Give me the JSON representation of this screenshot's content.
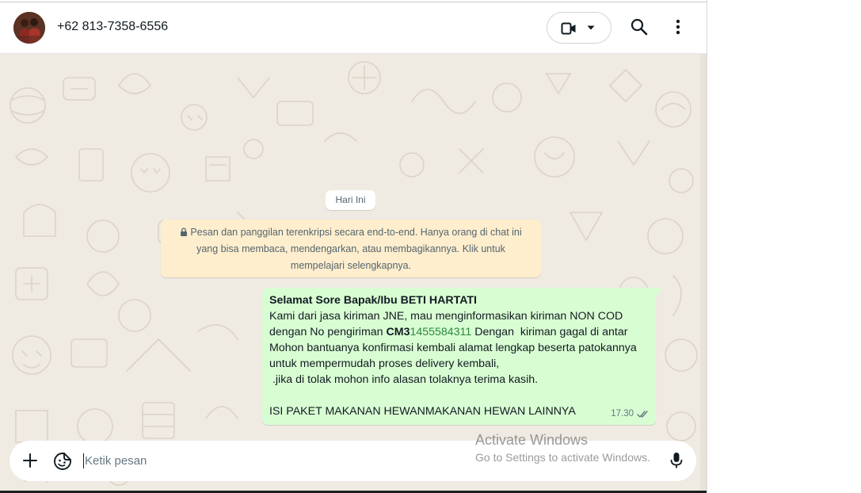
{
  "header": {
    "contact_name": "+62 813-7358-6556"
  },
  "chat": {
    "date_chip": "Hari Ini",
    "encryption_notice": "Pesan dan panggilan terenkripsi secara end-to-end. Hanya orang di chat ini yang bisa membaca, mendengarkan, atau membagikannya. Klik untuk mempelajari selengkapnya.",
    "message": {
      "line1": "Selamat Sore Bapak/Ibu BETI HARTATI",
      "line2": "Kami dari jasa kiriman JNE, mau menginformasikan kiriman NON COD",
      "line3_prefix": "dengan No pengiriman ",
      "line3_code": "CM3",
      "line3_number": "1455584311",
      "line3_suffix": " Dengan  kiriman gagal di antar",
      "line4": "Mohon bantuanya konfirmasi kembali alamat lengkap beserta patokannya",
      "line5": "untuk mempermudah proses delivery kembali,",
      "line6": " .jika di tolak mohon info alasan tolaknya terima kasih.",
      "line7": "ISI PAKET MAKANAN HEWANMAKANAN HEWAN LAINNYA",
      "time": "17.30",
      "status": "read"
    }
  },
  "composer": {
    "placeholder": "Ketik pesan"
  },
  "watermark": {
    "title": "Activate Windows",
    "subtitle": "Go to Settings to activate Windows."
  },
  "colors": {
    "chat_background": "#efeae2",
    "outgoing_bubble": "#d9fdd3",
    "notice_background": "#ffeecd",
    "number_highlight": "#2a8a3a",
    "read_ticks": "#667781"
  },
  "icons": [
    "video-call-icon",
    "chevron-down-icon",
    "search-icon",
    "more-options-icon",
    "lock-icon",
    "double-check-icon",
    "plus-icon",
    "sticker-icon",
    "mic-icon"
  ]
}
